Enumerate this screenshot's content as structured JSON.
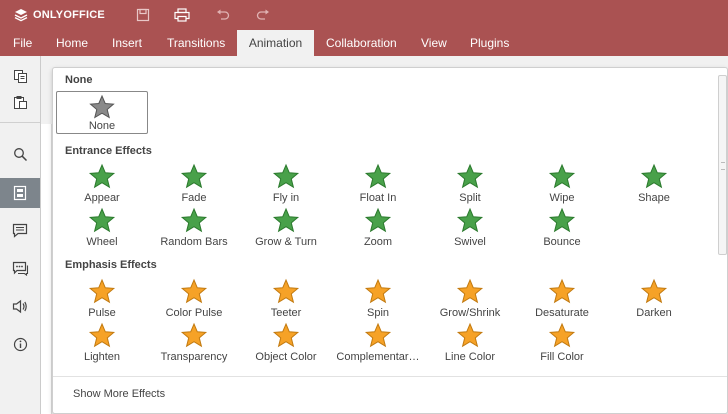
{
  "app": {
    "brand": "ONLYOFFICE"
  },
  "colors": {
    "header": "#aa5252",
    "entrance": "#49a14a",
    "emphasis": "#f6a227",
    "active_tool": "#7d858c"
  },
  "quick_access": [
    {
      "name": "save-icon"
    },
    {
      "name": "print-icon"
    },
    {
      "name": "undo-icon"
    },
    {
      "name": "redo-icon"
    }
  ],
  "menu": {
    "tabs": [
      "File",
      "Home",
      "Insert",
      "Transitions",
      "Animation",
      "Collaboration",
      "View",
      "Plugins"
    ],
    "active": "Animation"
  },
  "left_toolbar": [
    "copy-icon",
    "paste-icon",
    "search-icon",
    "slides-icon",
    "comments-icon",
    "chat-icon",
    "speaker-icon",
    "info-icon"
  ],
  "panel": {
    "none_section": "None",
    "none_item": "None",
    "entrance_title": "Entrance Effects",
    "entrance": [
      "Appear",
      "Fade",
      "Fly in",
      "Float In",
      "Split",
      "Wipe",
      "Shape",
      "Wheel",
      "Random Bars",
      "Grow & Turn",
      "Zoom",
      "Swivel",
      "Bounce"
    ],
    "emphasis_title": "Emphasis Effects",
    "emphasis": [
      "Pulse",
      "Color Pulse",
      "Teeter",
      "Spin",
      "Grow/Shrink",
      "Desaturate",
      "Darken",
      "Lighten",
      "Transparency",
      "Object Color",
      "Complementar…",
      "Line Color",
      "Fill Color"
    ],
    "show_more": "Show More Effects"
  }
}
